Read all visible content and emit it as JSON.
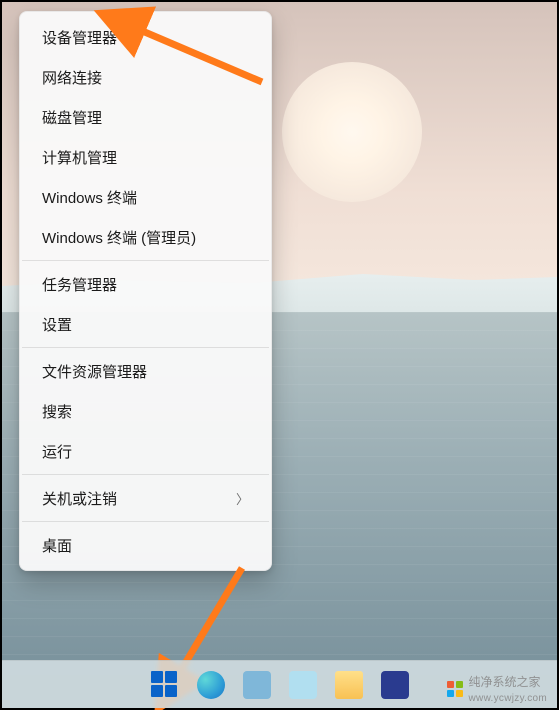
{
  "menu": {
    "items": [
      {
        "label": "设备管理器",
        "has_submenu": false
      },
      {
        "label": "网络连接",
        "has_submenu": false
      },
      {
        "label": "磁盘管理",
        "has_submenu": false
      },
      {
        "label": "计算机管理",
        "has_submenu": false
      },
      {
        "label": "Windows 终端",
        "has_submenu": false
      },
      {
        "label": "Windows 终端 (管理员)",
        "has_submenu": false
      }
    ],
    "items2": [
      {
        "label": "任务管理器",
        "has_submenu": false
      },
      {
        "label": "设置",
        "has_submenu": false
      }
    ],
    "items3": [
      {
        "label": "文件资源管理器",
        "has_submenu": false
      },
      {
        "label": "搜索",
        "has_submenu": false
      },
      {
        "label": "运行",
        "has_submenu": false
      }
    ],
    "items4": [
      {
        "label": "关机或注销",
        "has_submenu": true
      }
    ],
    "items5": [
      {
        "label": "桌面",
        "has_submenu": false
      }
    ]
  },
  "taskbar": {
    "icons": [
      "start",
      "edge",
      "blur1",
      "blur2",
      "folder",
      "blur3"
    ]
  },
  "watermark": {
    "text": "纯净系统之家",
    "url": "www.ycwjzy.com"
  },
  "annotations": {
    "arrow_color": "#ff7a1a"
  }
}
